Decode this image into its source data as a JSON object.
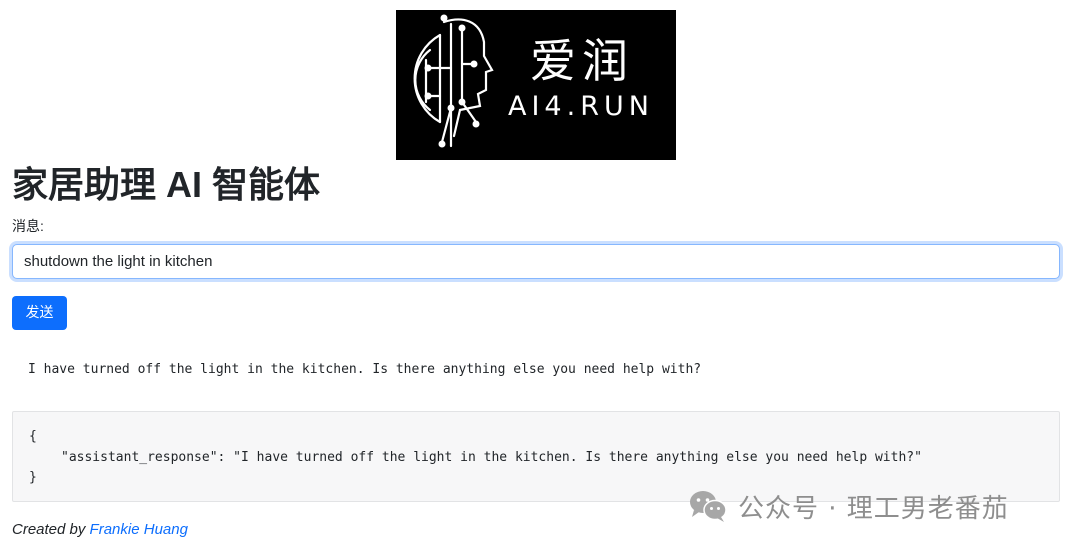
{
  "logo": {
    "brand_cn": "爱润",
    "brand_en": "AI4.RUN",
    "icon": "ai-head-circuit-icon"
  },
  "page": {
    "title": "家居助理 AI 智能体"
  },
  "form": {
    "message_label": "消息:",
    "message_value": "shutdown the light in kitchen",
    "send_label": "发送"
  },
  "response": {
    "text": "I have turned off the light in the kitchen. Is there anything else you need help with?",
    "json_open": "{",
    "json_line": "\"assistant_response\": \"I have turned off the light in the kitchen. Is there anything else you need help with?\"",
    "json_close": "}"
  },
  "footer": {
    "prefix": "Created by",
    "author": "Frankie Huang"
  },
  "watermark": {
    "text": "公众号 · 理工男老番茄",
    "icon": "wechat-icon"
  },
  "colors": {
    "primary": "#0d6efd",
    "text": "#212529",
    "code_bg": "#f7f7f8"
  }
}
